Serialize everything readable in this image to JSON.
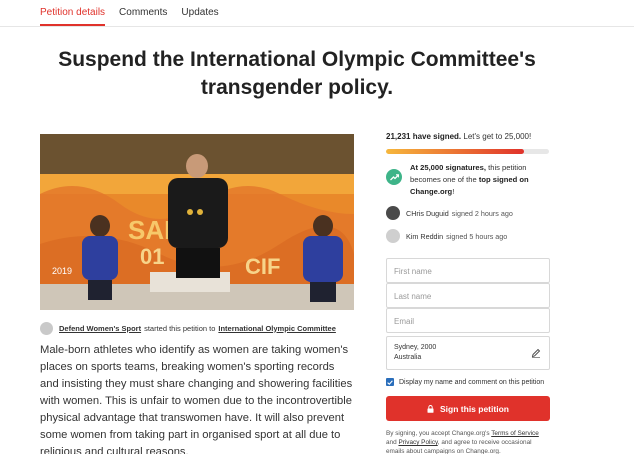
{
  "tabs": [
    {
      "label": "Petition details",
      "active": true
    },
    {
      "label": "Comments",
      "active": false
    },
    {
      "label": "Updates",
      "active": false
    }
  ],
  "headline": {
    "line1": "Suspend the International Olympic Committee's",
    "line2": "transgender policy."
  },
  "starter": {
    "author": "Defend Women's Sport",
    "action": "started this petition to",
    "target": "International Olympic Committee"
  },
  "body": {
    "paragraph": "Male-born athletes who identify as women are taking women's places on sports teams, breaking women's sporting records and insisting they must share changing and showering facilities with women. This is unfair to women due to the incontrovertible physical advantage that transwomen have. It will also prevent some women from taking part in organised sport at all due to religious and cultural reasons."
  },
  "sidebar": {
    "signed_count": "21,231 have signed.",
    "signed_goal": "Let's get to 25,000!",
    "progress_fraction": 0.849,
    "progress_colors": [
      "#f6b73c",
      "#e0322b"
    ],
    "milestone_lead": "At 25,000 signatures,",
    "milestone_mid": "this petition becomes one of the",
    "milestone_bold": "top signed on Change.org",
    "milestone_end": "!",
    "milestone_icon": "trending-up-icon",
    "recent": [
      {
        "name": "CHris Duguid",
        "action": "signed 2 hours ago"
      },
      {
        "name": "Kim Reddin",
        "action": "signed 5 hours ago"
      }
    ]
  },
  "form": {
    "first_name_placeholder": "First name",
    "last_name_placeholder": "Last name",
    "email_placeholder": "Email",
    "location_line1": "Sydney, 2000",
    "location_line2": "Australia",
    "display_checkbox_label": "Display my name and comment on this petition",
    "display_checked": true,
    "sign_button_label": "Sign this petition",
    "legal_prefix": "By signing, you accept Change.org's",
    "legal_terms": "Terms of Service",
    "legal_and": "and",
    "legal_privacy": "Privacy Policy",
    "legal_suffix": ", and agree to receive occasional emails about campaigns on Change.org."
  },
  "colors": {
    "accent": "#e0322b",
    "milestone_green": "#3eb489",
    "checkbox_blue": "#2a6ebb"
  }
}
